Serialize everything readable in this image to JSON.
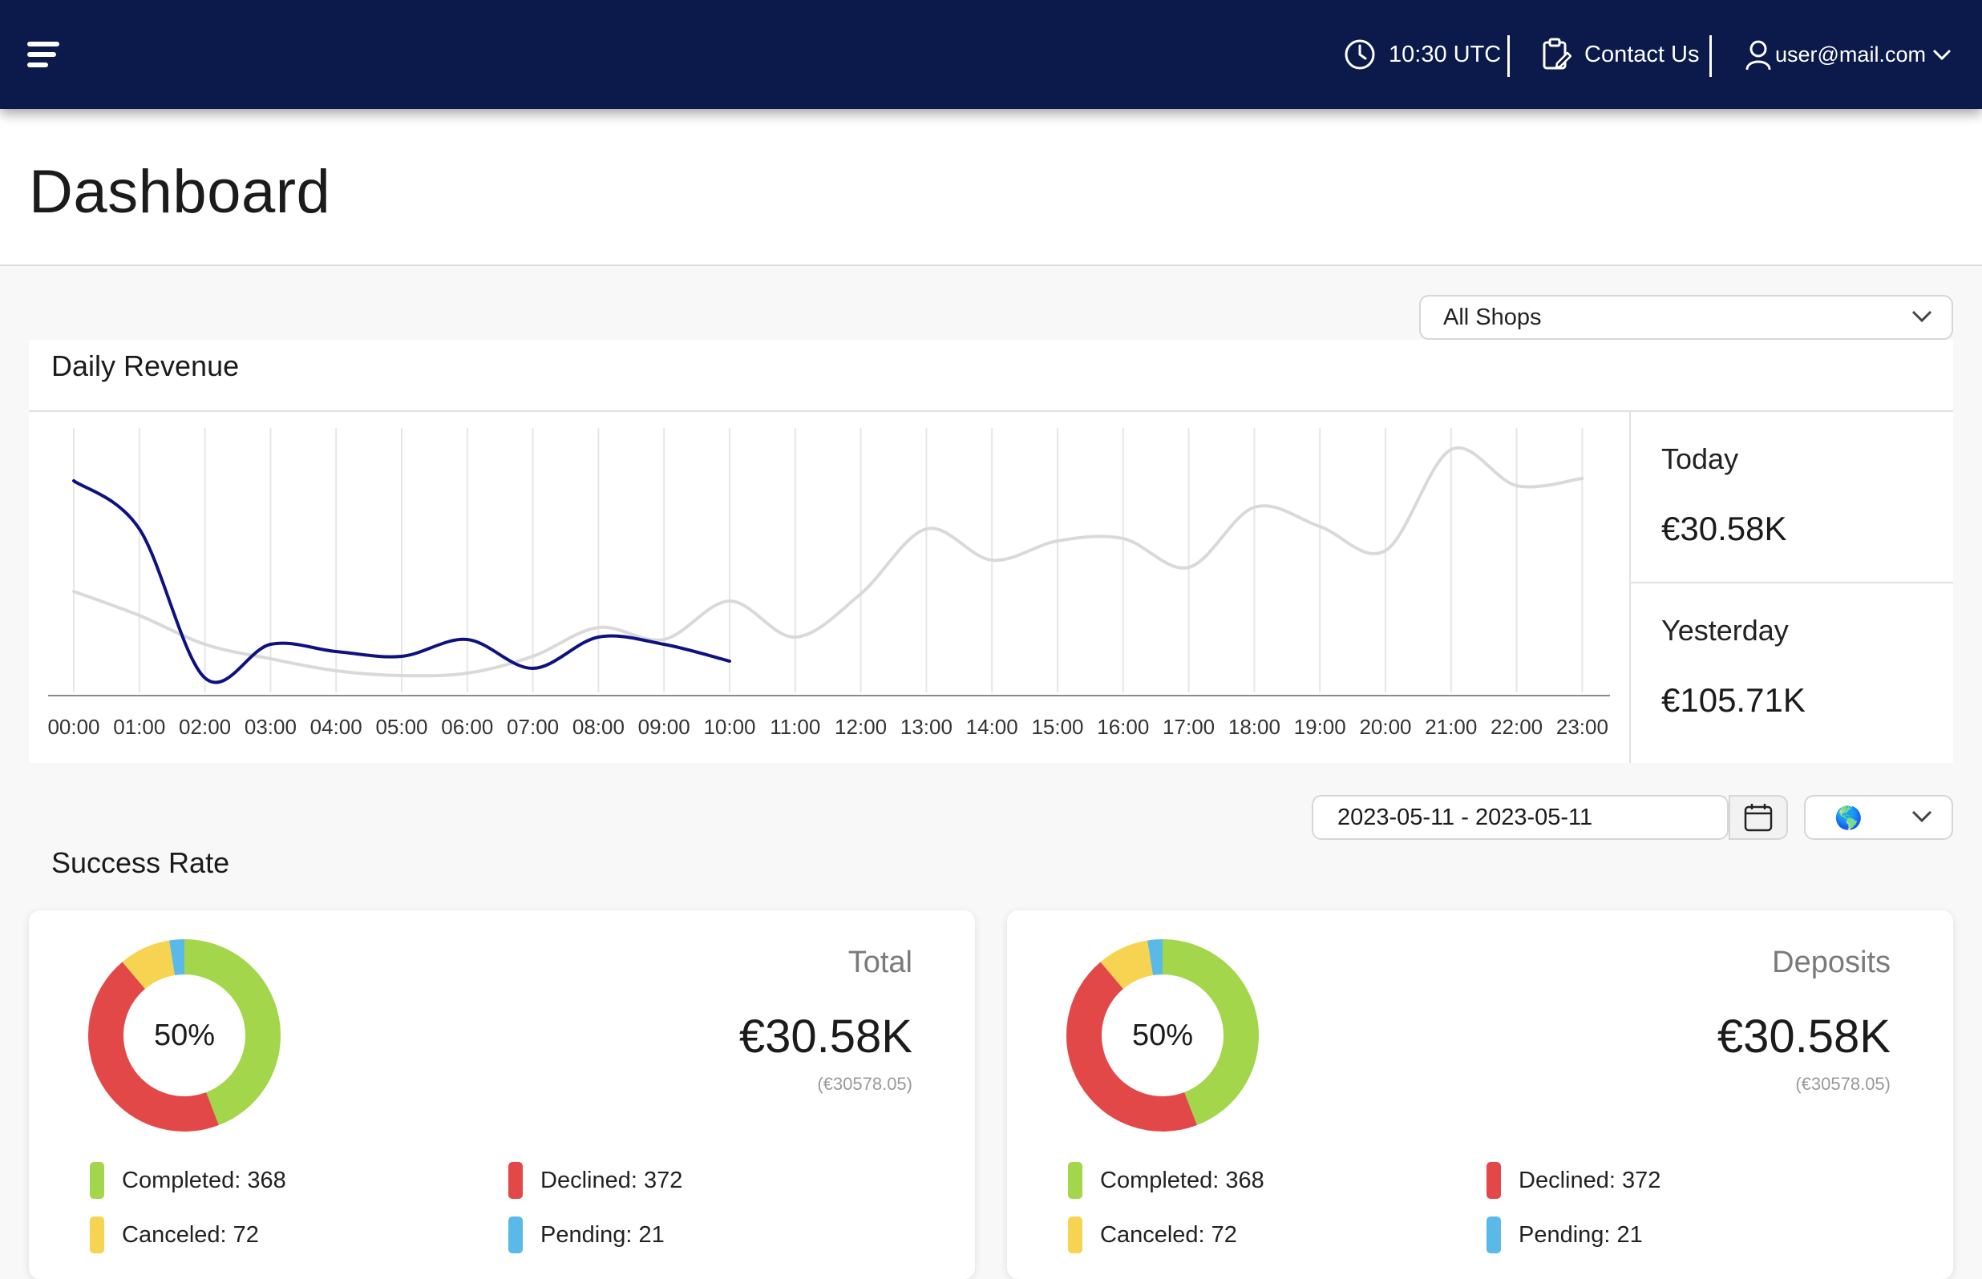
{
  "topbar": {
    "time": "10:30 UTC",
    "contact_label": "Contact Us",
    "user_email": "user@mail.com"
  },
  "page": {
    "title": "Dashboard"
  },
  "shop_select": {
    "value": "All Shops"
  },
  "daily_revenue": {
    "title": "Daily Revenue",
    "today_label": "Today",
    "today_value": "€30.58K",
    "yesterday_label": "Yesterday",
    "yesterday_value": "€105.71K"
  },
  "chart_data": {
    "type": "line",
    "x": [
      "00:00",
      "01:00",
      "02:00",
      "03:00",
      "04:00",
      "05:00",
      "06:00",
      "07:00",
      "08:00",
      "09:00",
      "10:00",
      "11:00",
      "12:00",
      "13:00",
      "14:00",
      "15:00",
      "16:00",
      "17:00",
      "18:00",
      "19:00",
      "20:00",
      "21:00",
      "22:00",
      "23:00"
    ],
    "series": [
      {
        "name": "today",
        "color": "#0d1280",
        "values": [
          88,
          68,
          6,
          20,
          17,
          15,
          22,
          10,
          23,
          20,
          13
        ]
      },
      {
        "name": "yesterday",
        "color": "#d9d9d9",
        "values": [
          42,
          32,
          20,
          14,
          9,
          7,
          8,
          15,
          27,
          22,
          38,
          23,
          41,
          68,
          55,
          63,
          64,
          52,
          77,
          69,
          59,
          101,
          86,
          89
        ]
      }
    ],
    "ylim": [
      0,
      110
    ],
    "grid": "vertical"
  },
  "date_range": {
    "value": "2023-05-11 - 2023-05-11"
  },
  "region_select": {
    "value": "🌎"
  },
  "success_rate": {
    "title": "Success Rate",
    "cards": [
      {
        "label": "Total",
        "amount": "€30.58K",
        "amount_exact": "(€30578.05)",
        "percent": "50%",
        "legend": [
          {
            "text": "Completed: 368",
            "color": "#a4d64b"
          },
          {
            "text": "Declined: 372",
            "color": "#e34848"
          },
          {
            "text": "Canceled: 72",
            "color": "#f6d350"
          },
          {
            "text": "Pending: 21",
            "color": "#5bb9e8"
          }
        ]
      },
      {
        "label": "Deposits",
        "amount": "€30.58K",
        "amount_exact": "(€30578.05)",
        "percent": "50%",
        "legend": [
          {
            "text": "Completed: 368",
            "color": "#a4d64b"
          },
          {
            "text": "Declined: 372",
            "color": "#e34848"
          },
          {
            "text": "Canceled: 72",
            "color": "#f6d350"
          },
          {
            "text": "Pending: 21",
            "color": "#5bb9e8"
          }
        ]
      }
    ]
  }
}
